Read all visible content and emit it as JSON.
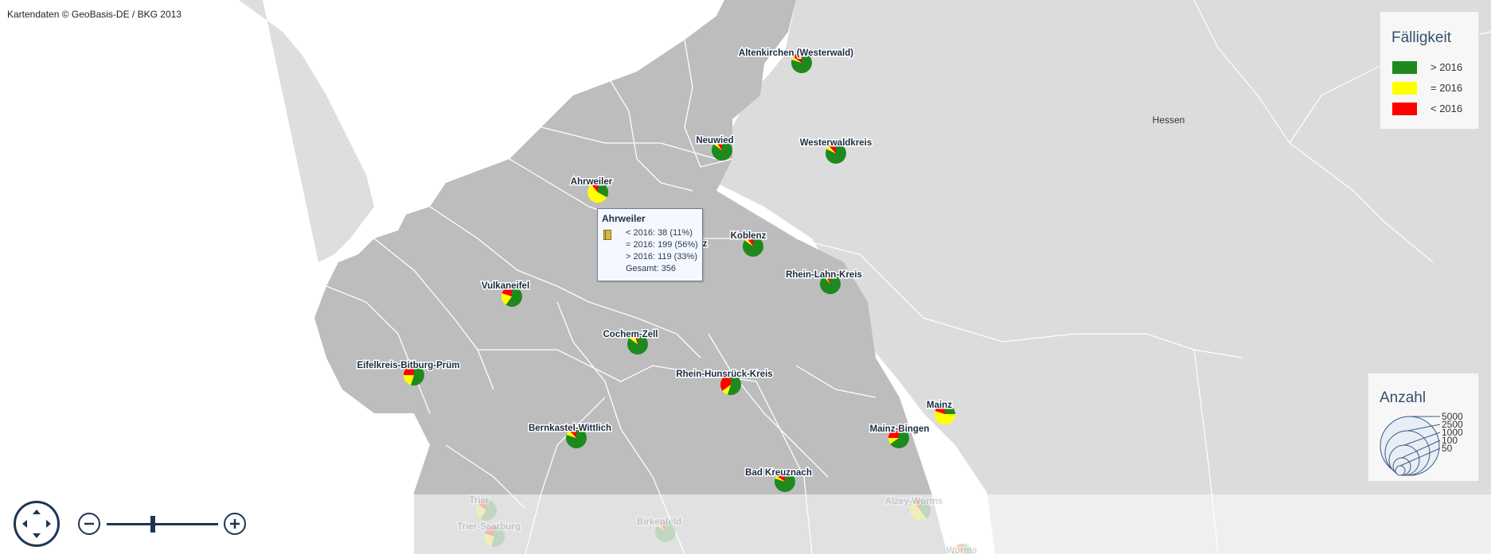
{
  "copyright": "Kartendaten © GeoBasis-DE / BKG 2013",
  "colors": {
    "green": "#1e8a1e",
    "yellow": "#ffff00",
    "red": "#ff0000",
    "region_fill": "#bdbdbd",
    "neighbor_fill": "#dedede",
    "border": "#ffffff",
    "control": "#1f3553"
  },
  "state_labels": [
    {
      "name": "Hessen"
    }
  ],
  "regions": [
    {
      "name": "Altenkirchen (Westerwald)",
      "green": 80,
      "yellow": 5,
      "red": 15
    },
    {
      "name": "Neuwied",
      "green": 85,
      "yellow": 5,
      "red": 10
    },
    {
      "name": "Westerwaldkreis",
      "green": 82,
      "yellow": 6,
      "red": 12
    },
    {
      "name": "Ahrweiler",
      "green": 33,
      "yellow": 56,
      "red": 11
    },
    {
      "name": "Koblenz",
      "green": 85,
      "yellow": 5,
      "red": 10
    },
    {
      "name": "Rhein-Lahn-Kreis",
      "green": 88,
      "yellow": 4,
      "red": 8
    },
    {
      "name": "Vulkaneifel",
      "green": 60,
      "yellow": 20,
      "red": 20
    },
    {
      "name": "Cochem-Zell",
      "green": 85,
      "yellow": 10,
      "red": 5
    },
    {
      "name": "Eifelkreis-Bitburg-Prüm",
      "green": 55,
      "yellow": 20,
      "red": 25
    },
    {
      "name": "Rhein-Hunsrück-Kreis",
      "green": 55,
      "yellow": 10,
      "red": 35
    },
    {
      "name": "Mainz",
      "green": 25,
      "yellow": 55,
      "red": 20
    },
    {
      "name": "Bernkastel-Wittlich",
      "green": 80,
      "yellow": 8,
      "red": 12
    },
    {
      "name": "Mainz-Bingen",
      "green": 65,
      "yellow": 10,
      "red": 25
    },
    {
      "name": "Bad Kreuznach",
      "green": 80,
      "yellow": 5,
      "red": 15
    },
    {
      "name": "Trier",
      "green": 60,
      "yellow": 25,
      "red": 15
    },
    {
      "name": "Trier-Saarburg",
      "green": 55,
      "yellow": 25,
      "red": 20
    },
    {
      "name": "Birkenfeld",
      "green": 85,
      "yellow": 5,
      "red": 10
    },
    {
      "name": "Alzey-Worms",
      "green": 40,
      "yellow": 50,
      "red": 10
    },
    {
      "name": "Worms",
      "green": 80,
      "yellow": 10,
      "red": 10
    }
  ],
  "hidden_label_fragment": "nz",
  "legend": {
    "title": "Fälligkeit",
    "items": [
      {
        "label": "> 2016",
        "color": "#1e8a1e"
      },
      {
        "label": "= 2016",
        "color": "#ffff00"
      },
      {
        "label": "< 2016",
        "color": "#ff0000"
      }
    ]
  },
  "size_legend": {
    "title": "Anzahl",
    "values": [
      "5000",
      "2500",
      "1000",
      "100",
      "50"
    ]
  },
  "tooltip": {
    "title": "Ahrweiler",
    "lines": [
      "< 2016: 38 (11%)",
      "= 2016: 199 (56%)",
      "> 2016: 119 (33%)",
      "Gesamt: 356"
    ]
  }
}
